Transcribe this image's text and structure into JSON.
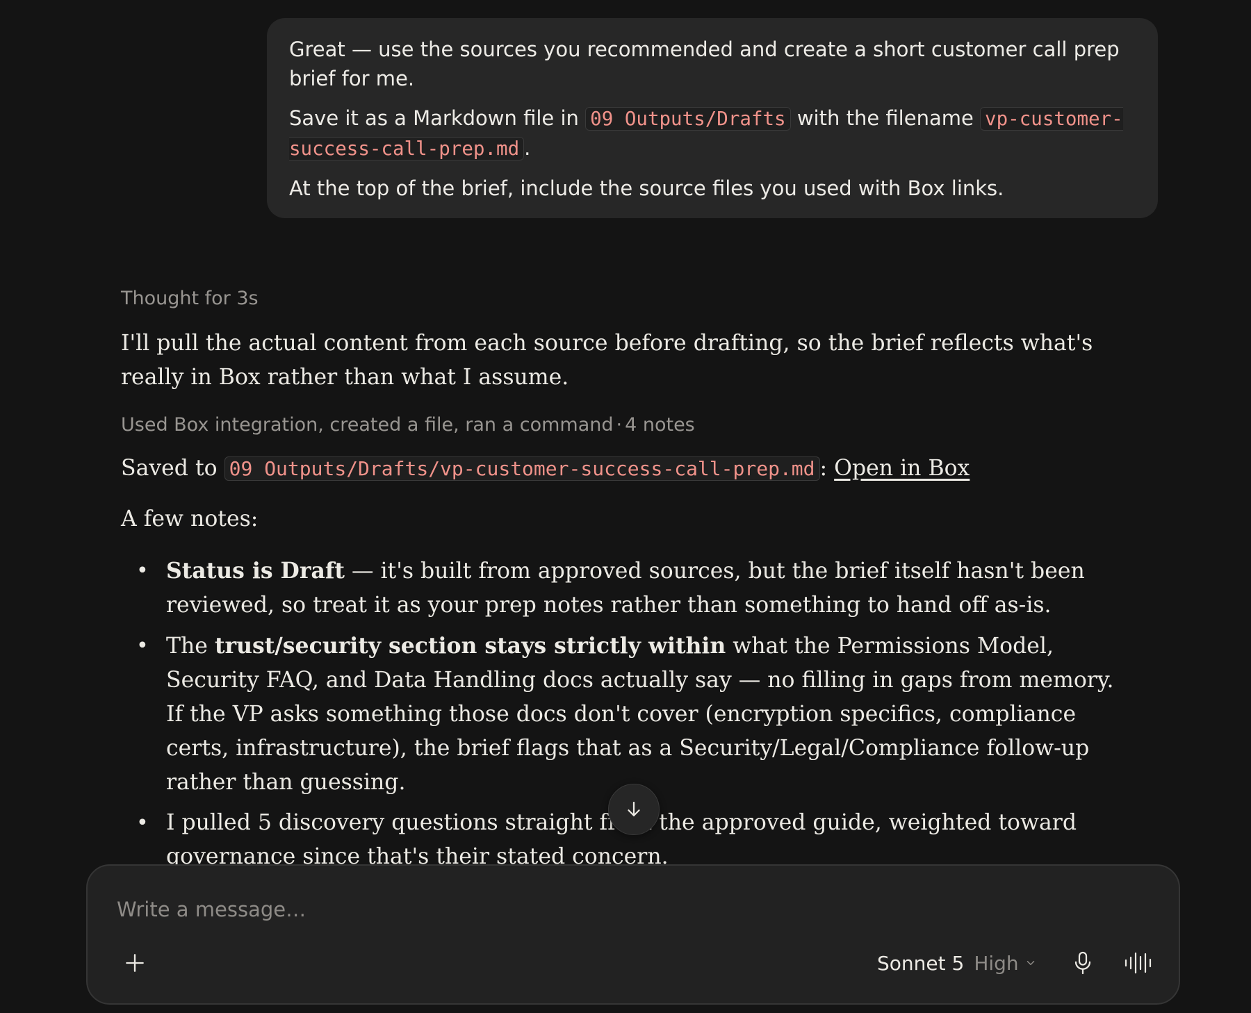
{
  "user_message": {
    "line1": "Great — use the sources you recommended and create a short customer call prep brief for me.",
    "save_prefix": "Save it as a Markdown file in ",
    "folder_code": "09 Outputs/Drafts",
    "save_middle": " with the filename ",
    "filename_code": "vp-customer-success-call-prep.md",
    "save_suffix": ".",
    "line3": "At the top of the brief, include the source files you used with Box links."
  },
  "assistant": {
    "thought_label": "Thought for 3s",
    "intro": "I'll pull the actual content from each source before drafting, so the brief reflects what's really in Box rather than what I assume.",
    "tools_summary": "Used Box integration, created a file, ran a command",
    "tools_separator": "·",
    "notes_count": "4 notes",
    "saved_prefix": "Saved to ",
    "saved_path": "09 Outputs/Drafts/vp-customer-success-call-prep.md",
    "saved_colon": ": ",
    "open_link": "Open in Box",
    "few_notes": "A few notes:",
    "notes": [
      {
        "bold_prefix": "Status is Draft",
        "text": " — it's built from approved sources, but the brief itself hasn't been reviewed, so treat it as your prep notes rather than something to hand off as-is."
      },
      {
        "prefix": "The ",
        "bold": "trust/security section stays strictly within",
        "text": " what the Permissions Model, Security FAQ, and Data Handling docs actually say — no filling in gaps from memory. If the VP asks something those docs don't cover (encryption specifics, compliance certs, infrastructure), the brief flags that as a Security/Legal/Compliance follow-up rather than guessing."
      },
      {
        "text": "I pulled 5 discovery questions straight from the approved guide, weighted toward governance since that's their stated concern."
      }
    ]
  },
  "composer": {
    "placeholder": "Write a message…",
    "model_name": "Sonnet 5",
    "effort": "High"
  },
  "icons": {
    "scroll": "arrow-down-icon",
    "add": "plus-icon",
    "chevron": "chevron-down-icon",
    "mic": "microphone-icon",
    "voice": "voice-waveform-icon"
  },
  "colors": {
    "background": "#141414",
    "bubble": "#272727",
    "code_text": "#F0928A",
    "muted_text": "#989591"
  }
}
